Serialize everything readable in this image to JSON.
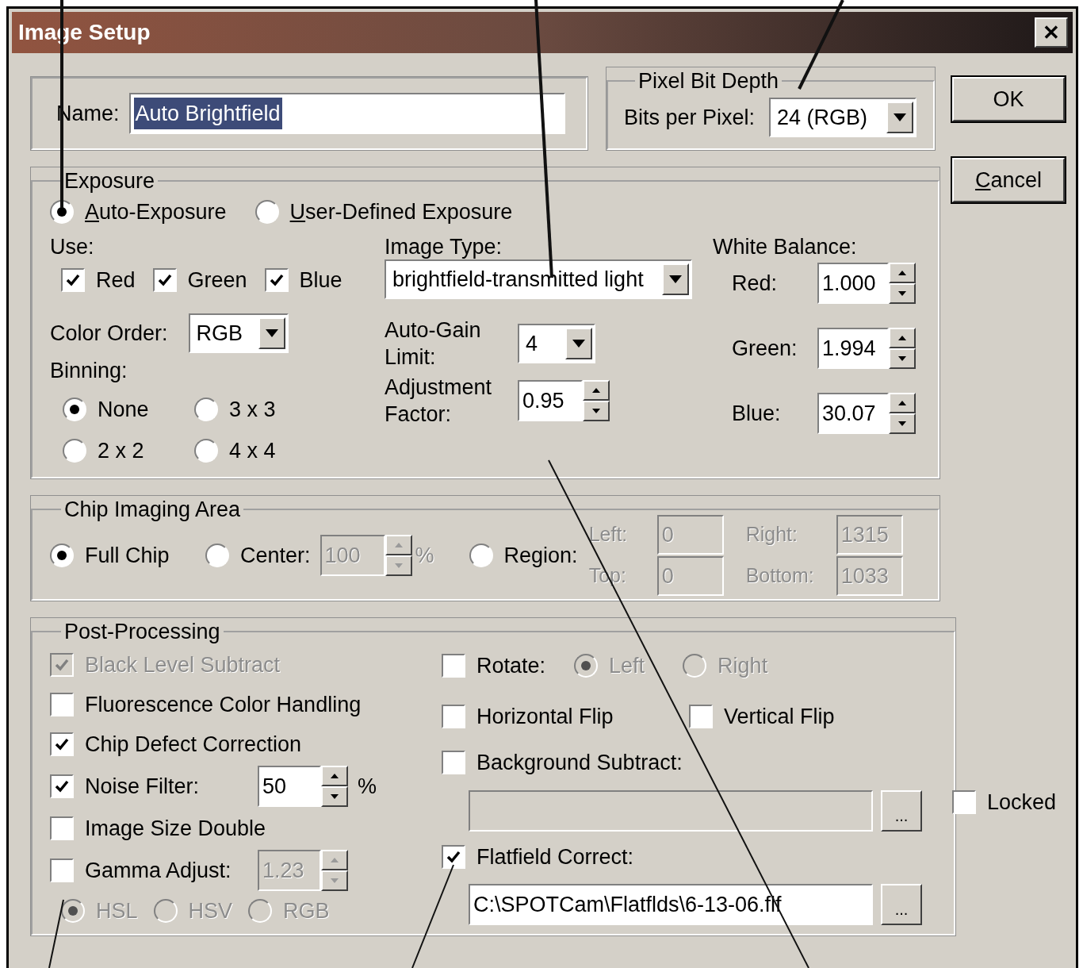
{
  "window": {
    "title": "Image Setup",
    "close": "✕"
  },
  "name": {
    "label": "Name:",
    "value": "Auto Brightfield",
    "selected": true
  },
  "pixel_bit_depth": {
    "title": "Pixel Bit Depth",
    "label": "Bits per Pixel:",
    "value": "24 (RGB)"
  },
  "buttons": [
    {
      "label": "OK",
      "access_key": false
    },
    {
      "label": "Cancel",
      "access_key": true
    }
  ],
  "exposure": {
    "title": "Exposure",
    "modes": [
      {
        "label": "Auto-Exposure",
        "selected": true,
        "access_key": true
      },
      {
        "label": "User-Defined Exposure",
        "selected": false,
        "access_key": true
      }
    ],
    "use": {
      "label": "Use:",
      "channels": [
        {
          "label": "Red",
          "checked": true
        },
        {
          "label": "Green",
          "checked": true
        },
        {
          "label": "Blue",
          "checked": true
        }
      ]
    },
    "color_order": {
      "label": "Color Order:",
      "value": "RGB"
    },
    "binning": {
      "label": "Binning:",
      "options": [
        {
          "label": "None",
          "selected": true
        },
        {
          "label": "3 x 3",
          "selected": false
        },
        {
          "label": "2 x 2",
          "selected": false
        },
        {
          "label": "4 x 4",
          "selected": false
        }
      ]
    },
    "image_type": {
      "label": "Image Type:",
      "value": "brightfield-transmitted light"
    },
    "auto_gain": {
      "label": "Auto-Gain Limit:",
      "value": "4"
    },
    "adjustment": {
      "label": "Adjustment Factor:",
      "value": "0.95"
    },
    "white_balance": {
      "title": "White Balance:",
      "channels": [
        {
          "label": "Red:",
          "value": "1.000"
        },
        {
          "label": "Green:",
          "value": "1.994"
        },
        {
          "label": "Blue:",
          "value": "30.07"
        }
      ]
    }
  },
  "chip_area": {
    "title": "Chip Imaging Area",
    "full": {
      "label": "Full Chip",
      "selected": true
    },
    "center": {
      "label": "Center:",
      "selected": false,
      "value": "100",
      "unit": "%",
      "disabled": true
    },
    "region": {
      "label": "Region:",
      "selected": false,
      "disabled": true,
      "fields": [
        {
          "label": "Left:",
          "value": "0"
        },
        {
          "label": "Right:",
          "value": "1315"
        },
        {
          "label": "Top:",
          "value": "0"
        },
        {
          "label": "Bottom:",
          "value": "1033"
        }
      ]
    }
  },
  "post_processing": {
    "title": "Post-Processing",
    "left": [
      {
        "kind": "checkbox",
        "label": "Black Level Subtract",
        "checked": true,
        "disabled": true
      },
      {
        "kind": "checkbox",
        "label": "Fluorescence Color Handling",
        "checked": false,
        "disabled": false
      },
      {
        "kind": "checkbox",
        "label": "Chip Defect Correction",
        "checked": true,
        "disabled": false
      },
      {
        "kind": "spin",
        "label": "Noise Filter:",
        "checked": true,
        "disabled": false,
        "value": "50",
        "unit": "%",
        "value_disabled": false
      },
      {
        "kind": "checkbox",
        "label": "Image Size Double",
        "checked": false,
        "disabled": false
      },
      {
        "kind": "spin",
        "label": "Gamma Adjust:",
        "checked": false,
        "disabled": false,
        "value": "1.23",
        "value_disabled": true
      },
      {
        "kind": "radios",
        "disabled": true,
        "options": [
          {
            "label": "HSL",
            "selected": true
          },
          {
            "label": "HSV",
            "selected": false
          },
          {
            "label": "RGB",
            "selected": false
          }
        ]
      }
    ],
    "right": [
      {
        "kind": "rotate",
        "label": "Rotate:",
        "checked": false,
        "options_disabled": true,
        "options": [
          {
            "label": "Left",
            "selected": true
          },
          {
            "label": "Right",
            "selected": false
          }
        ]
      },
      {
        "kind": "pair",
        "items": [
          {
            "label": "Horizontal Flip",
            "checked": false
          },
          {
            "label": "Vertical Flip",
            "checked": false
          }
        ]
      },
      {
        "kind": "file",
        "label": "Background Subtract:",
        "checked": false,
        "field_disabled": true,
        "browse": "..."
      },
      {
        "kind": "file",
        "label": "Flatfield Correct:",
        "checked": true,
        "field_disabled": false,
        "value": "C:\\SPOTCam\\Flatflds\\6-13-06.flf",
        "browse": "..."
      }
    ]
  },
  "locked": {
    "label": "Locked",
    "checked": false
  }
}
